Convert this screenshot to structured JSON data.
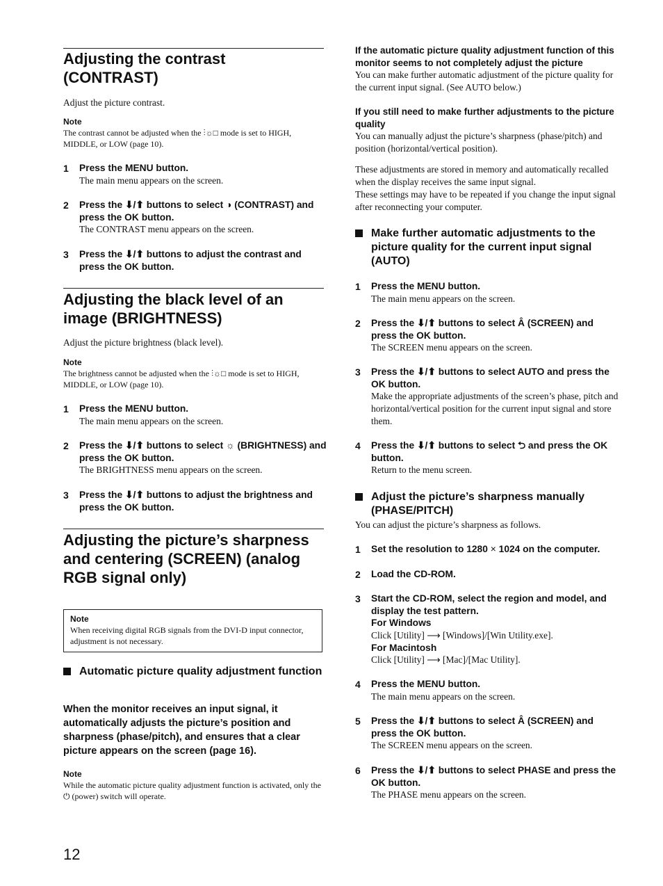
{
  "page_number": "12",
  "icons": {
    "down_up_arrows": "⬇/⬆",
    "contrast": "◑",
    "brightness": "☼",
    "screen": "Â",
    "return": "⮌",
    "eco_mode": "⫶☼□",
    "power": "⏻",
    "arrow_right": "⟶",
    "times": "×"
  },
  "contrast": {
    "title_line1": "Adjusting the contrast",
    "title_line2": "(CONTRAST)",
    "intro": "Adjust the picture contrast.",
    "note_label": "Note",
    "note_text_a": "The contrast cannot be adjusted when the",
    "note_text_b": "mode is set to HIGH, MIDDLE, or LOW (page 10).",
    "steps": [
      {
        "num": "1",
        "title": "Press the MENU button.",
        "desc": "The main menu appears on the screen."
      },
      {
        "num": "2",
        "title_a": "Press the",
        "title_b": "buttons to select",
        "title_c": "(CONTRAST) and press the OK button.",
        "desc": "The CONTRAST menu appears on the screen."
      },
      {
        "num": "3",
        "title_a": "Press the",
        "title_b": "buttons to adjust the contrast and press the OK button."
      }
    ]
  },
  "brightness": {
    "title_line1": "Adjusting the black level of an",
    "title_line2": "image (BRIGHTNESS)",
    "intro": "Adjust the picture brightness (black level).",
    "note_label": "Note",
    "note_text_a": "The brightness cannot be adjusted when the",
    "note_text_b": "mode is set to HIGH, MIDDLE, or LOW (page 10).",
    "steps": [
      {
        "num": "1",
        "title": "Press the MENU button.",
        "desc": "The main menu appears on the screen."
      },
      {
        "num": "2",
        "title_a": "Press the",
        "title_b": "buttons to select",
        "title_c": "(BRIGHTNESS) and press the OK button.",
        "desc": "The BRIGHTNESS menu appears on the screen."
      },
      {
        "num": "3",
        "title_a": "Press the",
        "title_b": "buttons to adjust the brightness and press the OK button."
      }
    ]
  },
  "screen": {
    "title_line1": "Adjusting the picture’s sharpness",
    "title_line2": "and centering (SCREEN) (analog",
    "title_line3": "RGB signal only)",
    "boxed_note_label": "Note",
    "boxed_note_text": "When receiving digital RGB signals from the DVI-D input connector, adjustment is not necessary.",
    "auto_function_heading": "Automatic picture quality adjustment function",
    "auto_function_bold": "When the monitor receives an input signal, it automatically adjusts the picture’s position and sharpness (phase/pitch), and ensures that a clear picture appears on the screen (page 16).",
    "note_label": "Note",
    "note_text_a": "While the automatic picture quality adjustment function is activated, only the",
    "note_text_b": "(power) switch will operate."
  },
  "right": {
    "if_auto_heading": "If the automatic picture quality adjustment function of this monitor seems to not completely adjust the picture",
    "if_auto_text": "You can make further automatic adjustment of the picture quality for the current input signal. (See AUTO below.)",
    "if_still_heading": "If you still need to make further adjustments to the picture quality",
    "if_still_text": "You can manually adjust the picture’s sharpness (phase/pitch) and position (horizontal/vertical position).",
    "stored_text_1": "These adjustments are stored in memory and automatically recalled when the display receives the same input signal.",
    "stored_text_2": "These settings may have to be repeated if you change the input signal after reconnecting your computer.",
    "auto_section": {
      "heading": "Make further automatic adjustments to the picture quality for the current input signal (AUTO)",
      "steps": [
        {
          "num": "1",
          "title": "Press the MENU button.",
          "desc": "The main menu appears on the screen."
        },
        {
          "num": "2",
          "title_a": "Press the",
          "title_b": "buttons to select",
          "title_c": "(SCREEN) and press the OK button.",
          "desc": "The SCREEN menu appears on the screen."
        },
        {
          "num": "3",
          "title_a": "Press the",
          "title_b": "buttons to select AUTO and press the OK button.",
          "desc": "Make the appropriate adjustments of the screen’s phase, pitch and horizontal/vertical position for the current input signal and store them."
        },
        {
          "num": "4",
          "title_a": "Press the",
          "title_b": "buttons to select",
          "title_c": "and press the OK button.",
          "desc": "Return to the menu screen."
        }
      ]
    },
    "manual_section": {
      "heading": "Adjust the picture’s sharpness manually (PHASE/PITCH)",
      "intro": "You can adjust the picture’s sharpness as follows.",
      "steps": [
        {
          "num": "1",
          "title_a": "Set the resolution to 1280",
          "title_b": "1024 on the computer."
        },
        {
          "num": "2",
          "title": "Load the CD-ROM."
        },
        {
          "num": "3",
          "title": "Start the CD-ROM, select the region and model, and display the test pattern.",
          "win_label": "For Windows",
          "win_a": "Click [Utility]",
          "win_b": "[Windows]/[Win Utility.exe].",
          "mac_label": "For Macintosh",
          "mac_a": "Click [Utility]",
          "mac_b": "[Mac]/[Mac Utility]."
        },
        {
          "num": "4",
          "title": "Press the MENU button.",
          "desc": "The main menu appears on the screen."
        },
        {
          "num": "5",
          "title_a": "Press the",
          "title_b": "buttons to select",
          "title_c": "(SCREEN) and press the OK button.",
          "desc": "The SCREEN menu appears on the screen."
        },
        {
          "num": "6",
          "title_a": "Press the",
          "title_b": "buttons to select PHASE and press the OK button.",
          "desc": "The PHASE menu appears on the screen."
        }
      ]
    }
  }
}
